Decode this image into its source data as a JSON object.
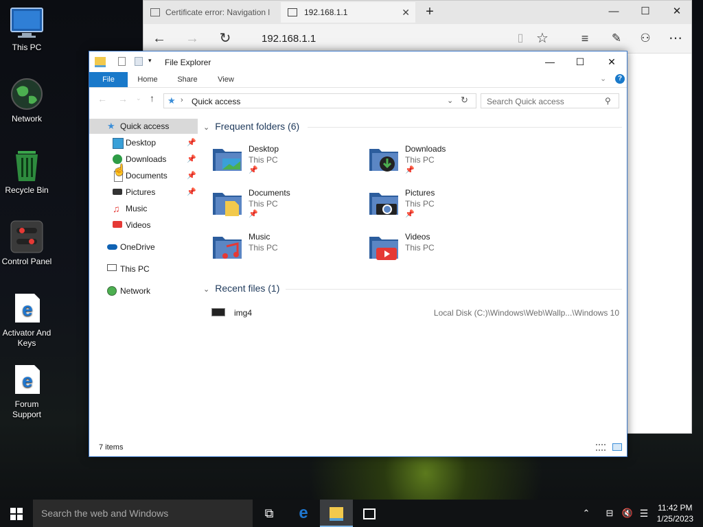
{
  "desktop": {
    "icons": [
      {
        "label": "This PC"
      },
      {
        "label": "Network"
      },
      {
        "label": "Recycle Bin"
      },
      {
        "label": "Control Panel"
      },
      {
        "label": "Activator And Keys"
      },
      {
        "label": "Forum Support"
      }
    ]
  },
  "browser": {
    "tabs": [
      {
        "label": "Certificate error: Navigation l"
      },
      {
        "label": "192.168.1.1"
      }
    ],
    "new_tab": "+",
    "url": "192.168.1.1"
  },
  "explorer": {
    "title": "File Explorer",
    "ribbon_tabs": [
      "File",
      "Home",
      "Share",
      "View"
    ],
    "address": "Quick access",
    "search_placeholder": "Search Quick access",
    "nav": [
      {
        "label": "Quick access",
        "pinned": false
      },
      {
        "label": "Desktop",
        "pinned": true
      },
      {
        "label": "Downloads",
        "pinned": true
      },
      {
        "label": "Documents",
        "pinned": true
      },
      {
        "label": "Pictures",
        "pinned": true
      },
      {
        "label": "Music",
        "pinned": false
      },
      {
        "label": "Videos",
        "pinned": false
      },
      {
        "label": "OneDrive",
        "pinned": false
      },
      {
        "label": "This PC",
        "pinned": false
      },
      {
        "label": "Network",
        "pinned": false
      }
    ],
    "frequent_header": "Frequent folders (6)",
    "folders": [
      {
        "name": "Desktop",
        "location": "This PC",
        "pinned": true
      },
      {
        "name": "Downloads",
        "location": "This PC",
        "pinned": true
      },
      {
        "name": "Documents",
        "location": "This PC",
        "pinned": true
      },
      {
        "name": "Pictures",
        "location": "This PC",
        "pinned": true
      },
      {
        "name": "Music",
        "location": "This PC",
        "pinned": false
      },
      {
        "name": "Videos",
        "location": "This PC",
        "pinned": false
      }
    ],
    "recent_header": "Recent files (1)",
    "recent": [
      {
        "name": "img4",
        "path": "Local Disk (C:)\\Windows\\Web\\Wallp...\\Windows 10"
      }
    ],
    "status": "7 items"
  },
  "taskbar": {
    "search_placeholder": "Search the web and Windows",
    "time": "11:42 PM",
    "date": "1/25/2023"
  },
  "colors": {
    "accent": "#1979ca",
    "folder": "#5a7fb8",
    "desktop_bg": "#10131a"
  }
}
